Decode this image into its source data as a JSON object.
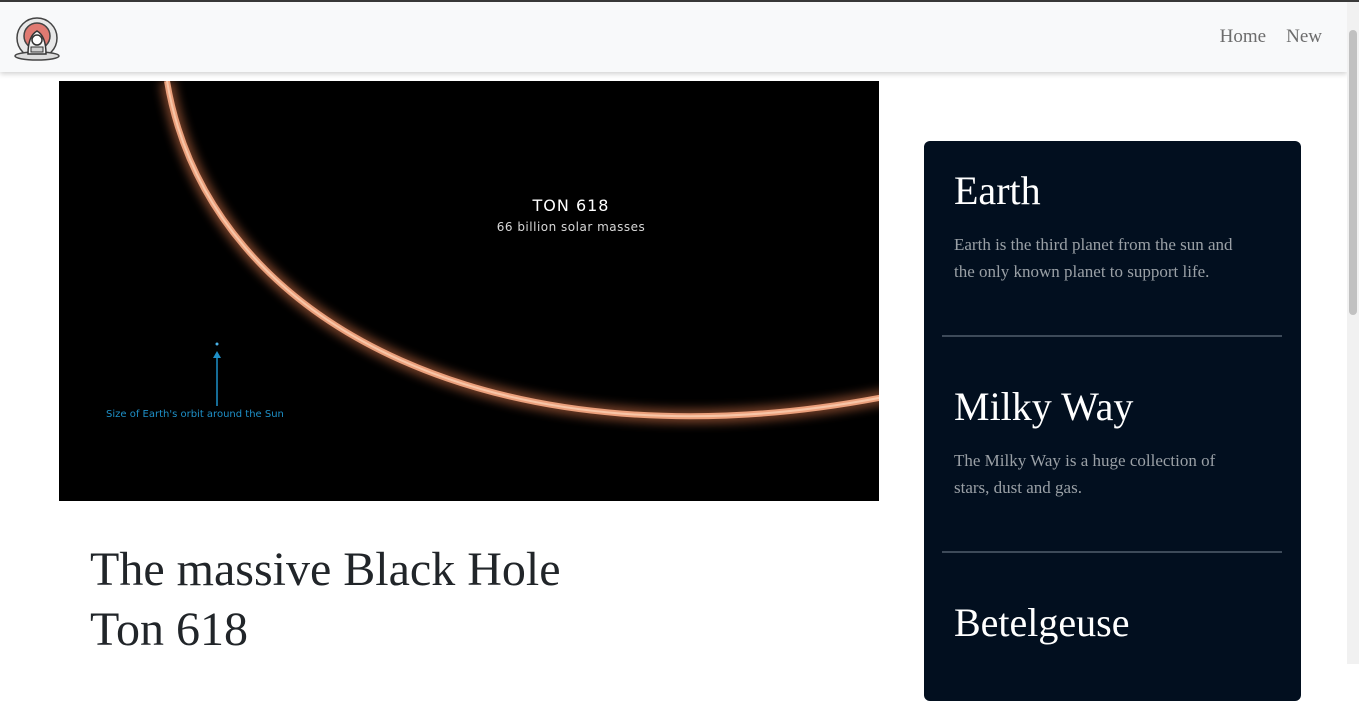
{
  "navbar": {
    "logo_icon": "astronaut-logo-icon",
    "links": [
      {
        "label": "Home"
      },
      {
        "label": "New"
      }
    ]
  },
  "hero": {
    "image_icon": "black-hole-image",
    "object_name": "TON 618",
    "object_mass": "66 billion solar masses",
    "scale_note": "Size of Earth's orbit around the Sun"
  },
  "article": {
    "title_line1": "The massive Black Hole",
    "title_line2": "Ton 618"
  },
  "sidebar": {
    "cards": [
      {
        "title": "Earth",
        "text": "Earth is the third planet from the sun and the only known planet to support life."
      },
      {
        "title": "Milky Way",
        "text": "The Milky Way is a huge collection of stars, dust and gas."
      },
      {
        "title": "Betelgeuse",
        "text": ""
      }
    ]
  },
  "colors": {
    "navbar_bg": "#f8f9fa",
    "sidebar_bg": "#020f1f",
    "title_text": "#212529",
    "ring_glow": "#e8a079",
    "scale_label": "#1e90c8"
  }
}
